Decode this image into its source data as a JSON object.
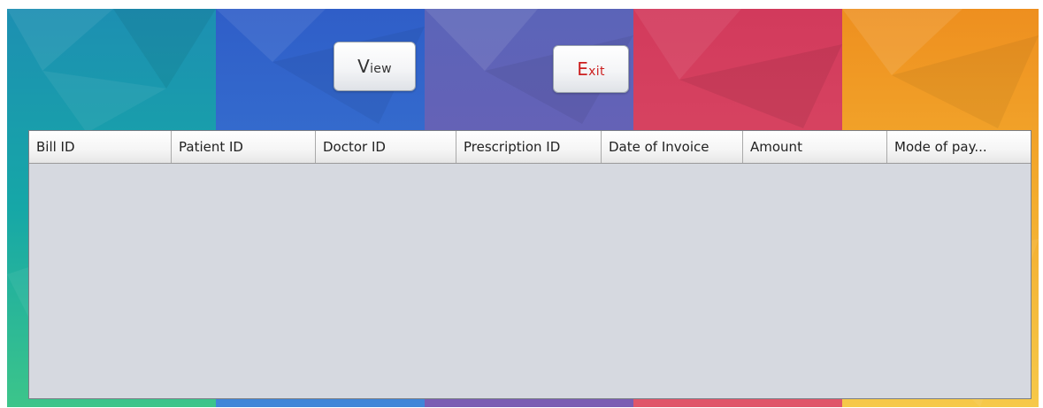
{
  "toolbar": {
    "view_button": {
      "first": "V",
      "rest": "iew"
    },
    "exit_button": {
      "first": "E",
      "rest": "xit"
    }
  },
  "table": {
    "columns": [
      "Bill ID",
      "Patient ID",
      "Doctor ID",
      "Prescription ID",
      "Date of Invoice",
      "Amount",
      "Mode of pay..."
    ],
    "rows": []
  },
  "colors": {
    "panel_teal": "#1fa6ae",
    "panel_blue": "#3a67c6",
    "panel_purple": "#6a6fb8",
    "panel_red": "#d9405f",
    "panel_orange": "#f0a531",
    "table_body": "#d6d9e0",
    "exit_text": "#cc1f1f"
  }
}
